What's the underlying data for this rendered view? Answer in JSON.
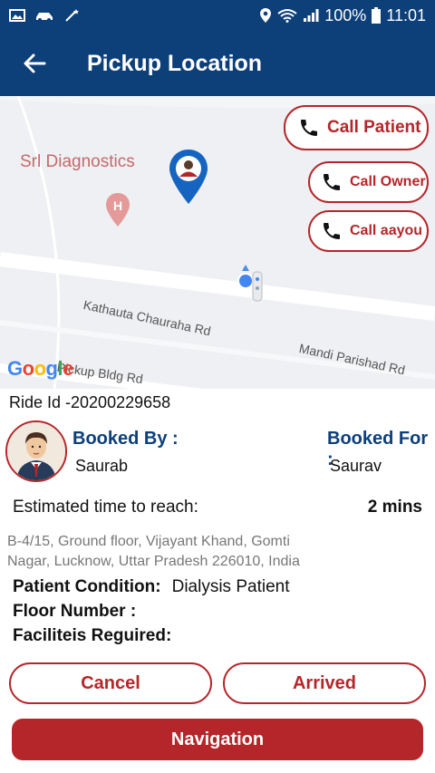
{
  "status_bar": {
    "battery": "100%",
    "time": "11:01",
    "icons": [
      "image-icon",
      "car-icon",
      "wand-icon",
      "location-pin-icon",
      "wifi-icon",
      "signal-icon",
      "battery-icon"
    ]
  },
  "header": {
    "title": "Pickup Location",
    "back_icon": "arrow-left-icon"
  },
  "map": {
    "place_label": "Srl Diagnostics",
    "roads": [
      "Kathauta Chauraha Rd",
      "Mandi Parishad Rd",
      "Pickup Bldg Rd"
    ],
    "provider": "Google",
    "buttons": {
      "call_patient": "Call Patient",
      "call_owner": "Call Owner",
      "call_aayou": "Call aayou"
    }
  },
  "ride": {
    "ride_id": "Ride Id -20200229658",
    "booked_by_label": "Booked By :",
    "booked_by_value": "Saurab",
    "booked_for_label": "Booked For :",
    "booked_for_value": "Saurav",
    "eta_label": "Estimated time to reach:",
    "eta_value": "2 mins",
    "address": "B-4/15, Ground floor, Vijayant Khand, Gomti Nagar, Lucknow, Uttar Pradesh 226010, India",
    "patient_condition_label": "Patient Condition:",
    "patient_condition_value": "Dialysis Patient",
    "floor_number_label": "Floor Number :",
    "facilities_label": "Faciliteis Reguired:"
  },
  "actions": {
    "cancel": "Cancel",
    "arrived": "Arrived",
    "navigation": "Navigation"
  },
  "colors": {
    "primary_blue": "#0d3f79",
    "accent_red": "#b5262a"
  }
}
